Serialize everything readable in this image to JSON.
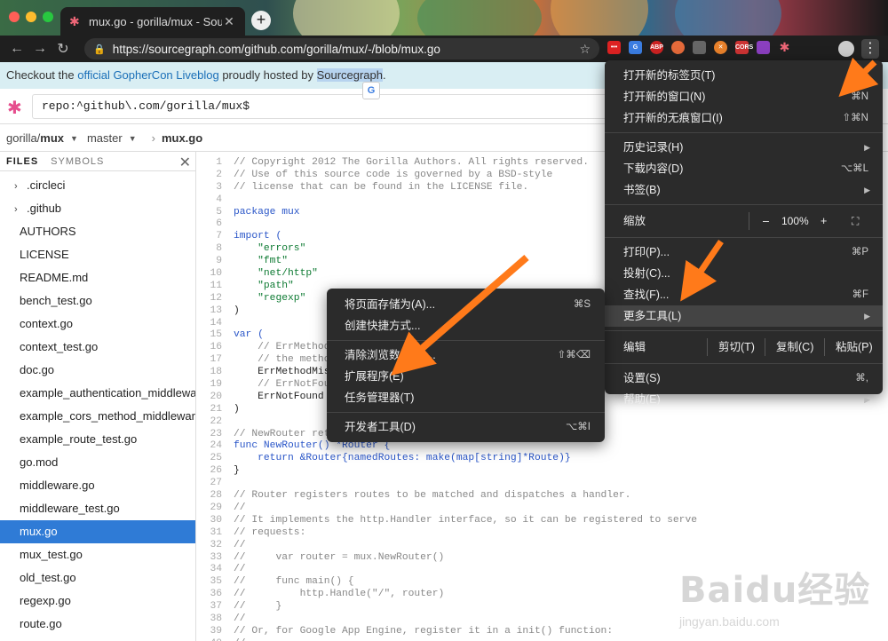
{
  "browser": {
    "tab_title": "mux.go - gorilla/mux - Sourcegr",
    "url": "https://sourcegraph.com/github.com/gorilla/mux/-/blob/mux.go",
    "extension_labels": [
      "",
      "",
      "ABP",
      "",
      "",
      "",
      "CORS",
      "",
      ""
    ]
  },
  "banner": {
    "prefix": "Checkout the ",
    "link": "official GopherCon Liveblog",
    "middle": " proudly hosted by ",
    "highlight": "Sourcegraph",
    "suffix": "."
  },
  "search": {
    "value": "repo:^github\\.com/gorilla/mux$"
  },
  "breadcrumb": {
    "owner": "gorilla/",
    "repo": "mux",
    "branch": "master",
    "file": "mux.go"
  },
  "sidebar": {
    "tab_files": "FILES",
    "tab_symbols": "SYMBOLS",
    "close": "✕",
    "files": [
      {
        "name": ".circleci",
        "dir": true
      },
      {
        "name": ".github",
        "dir": true
      },
      {
        "name": "AUTHORS"
      },
      {
        "name": "LICENSE"
      },
      {
        "name": "README.md"
      },
      {
        "name": "bench_test.go"
      },
      {
        "name": "context.go"
      },
      {
        "name": "context_test.go"
      },
      {
        "name": "doc.go"
      },
      {
        "name": "example_authentication_middleware_test.go"
      },
      {
        "name": "example_cors_method_middleware_test.go"
      },
      {
        "name": "example_route_test.go"
      },
      {
        "name": "go.mod"
      },
      {
        "name": "middleware.go"
      },
      {
        "name": "middleware_test.go"
      },
      {
        "name": "mux.go",
        "selected": true
      },
      {
        "name": "mux_test.go"
      },
      {
        "name": "old_test.go"
      },
      {
        "name": "regexp.go"
      },
      {
        "name": "route.go"
      }
    ]
  },
  "code": [
    "// Copyright 2012 The Gorilla Authors. All rights reserved.",
    "// Use of this source code is governed by a BSD-style",
    "// license that can be found in the LICENSE file.",
    "",
    "package mux",
    "",
    "import (",
    "    \"errors\"",
    "    \"fmt\"",
    "    \"net/http\"",
    "    \"path\"",
    "    \"regexp\"",
    ")",
    "",
    "var (",
    "    // ErrMethodMismatch is returned when the method in the request does not match",
    "    // the method defined against the route.",
    "    ErrMethodMismatch = errors.New(\"method mismatch\")",
    "    // ErrNotFound is returned when no route match is found.",
    "    ErrNotFound = errors.New(\"no matching route was found\")",
    ")",
    "",
    "// NewRouter returns a new router instance.",
    "func NewRouter() *Router {",
    "    return &Router{namedRoutes: make(map[string]*Route)}",
    "}",
    "",
    "// Router registers routes to be matched and dispatches a handler.",
    "//",
    "// It implements the http.Handler interface, so it can be registered to serve",
    "// requests:",
    "//",
    "//     var router = mux.NewRouter()",
    "//",
    "//     func main() {",
    "//         http.Handle(\"/\", router)",
    "//     }",
    "//",
    "// Or, for Google App Engine, register it in a init() function:",
    "//"
  ],
  "chrome_menu": {
    "new_tab": "打开新的标签页(T)",
    "new_tab_sc": "",
    "new_window": "打开新的窗口(N)",
    "new_window_sc": "⌘N",
    "incognito": "打开新的无痕窗口(I)",
    "incognito_sc": "⇧⌘N",
    "history": "历史记录(H)",
    "downloads": "下载内容(D)",
    "downloads_sc": "⌥⌘L",
    "bookmarks": "书签(B)",
    "zoom": "缩放",
    "zoom_minus": "–",
    "zoom_value": "100%",
    "zoom_plus": "+",
    "zoom_full": "⛶",
    "print": "打印(P)...",
    "print_sc": "⌘P",
    "cast": "投射(C)...",
    "find": "查找(F)...",
    "find_sc": "⌘F",
    "more_tools": "更多工具(L)",
    "edit": "编辑",
    "cut": "剪切(T)",
    "copy": "复制(C)",
    "paste": "粘贴(P)",
    "settings": "设置(S)",
    "settings_sc": "⌘,",
    "help": "帮助(E)"
  },
  "submenu": {
    "save_page": "将页面存储为(A)...",
    "save_page_sc": "⌘S",
    "create_shortcut": "创建快捷方式...",
    "clear_data": "清除浏览数据(C)...",
    "clear_data_sc": "⇧⌘⌫",
    "extensions": "扩展程序(E)",
    "task_manager": "任务管理器(T)",
    "devtools": "开发者工具(D)",
    "devtools_sc": "⌥⌘I"
  },
  "watermark": {
    "logo": "Baidu经验",
    "url": "jingyan.baidu.com"
  },
  "colors": {
    "accent": "#2f7bd6",
    "arrow": "#ff7a1a",
    "menu_bg": "#2b2b2b",
    "banner_bg": "#d9eef3"
  }
}
